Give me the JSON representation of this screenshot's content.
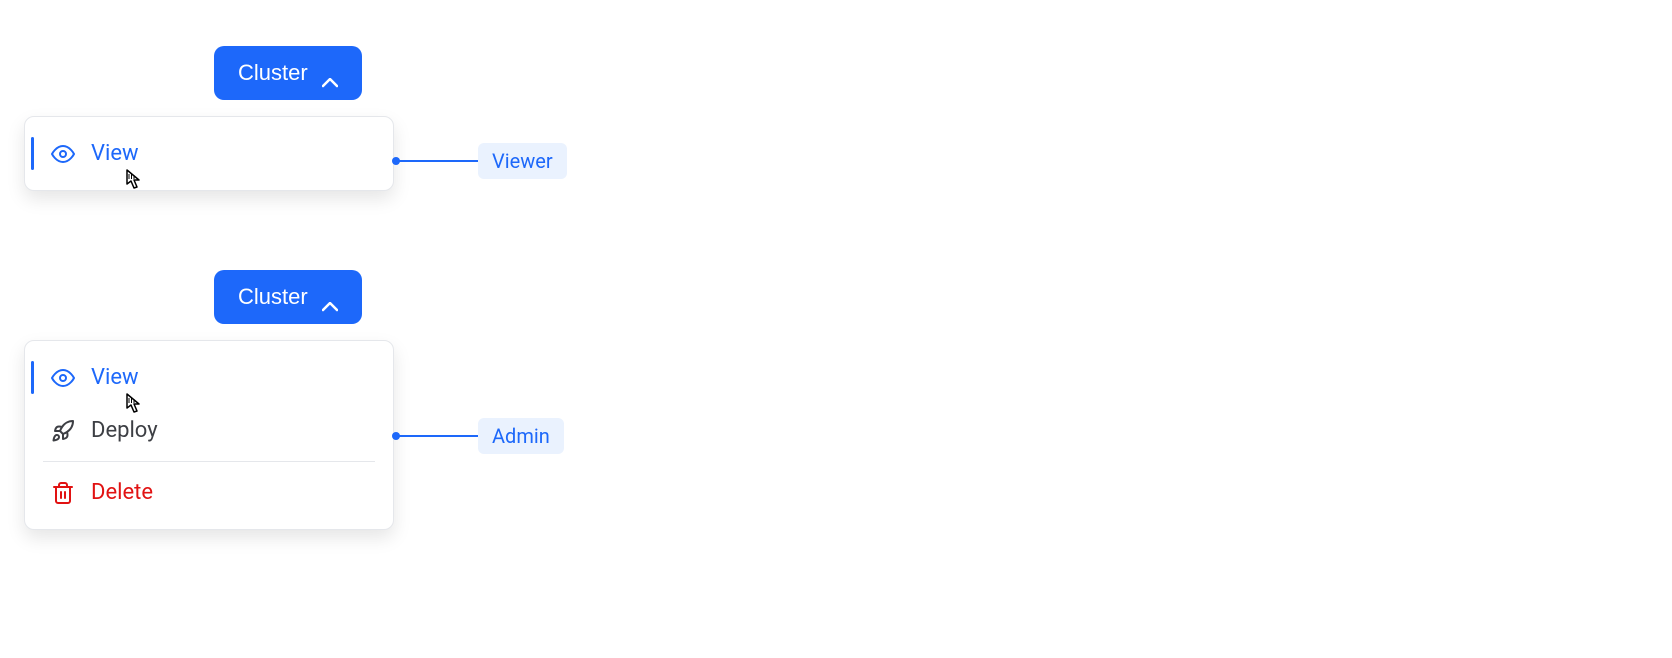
{
  "examples": [
    {
      "button_label": "Cluster",
      "role_label": "Viewer",
      "menu": {
        "view_label": "View"
      }
    },
    {
      "button_label": "Cluster",
      "role_label": "Admin",
      "menu": {
        "view_label": "View",
        "deploy_label": "Deploy",
        "delete_label": "Delete"
      }
    }
  ]
}
